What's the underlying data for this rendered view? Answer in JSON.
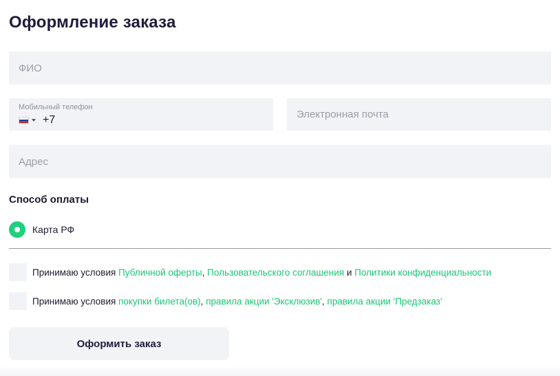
{
  "page": {
    "title": "Оформление заказа"
  },
  "form": {
    "name_placeholder": "ФИО",
    "phone": {
      "label": "Мобильный телефон",
      "country_icon": "russia-flag-icon",
      "code": "+7"
    },
    "email_placeholder": "Электронная почта",
    "address_placeholder": "Адрес"
  },
  "payment": {
    "section_title": "Способ оплаты",
    "options": [
      {
        "label": "Карта РФ",
        "selected": true
      }
    ]
  },
  "agreements": [
    {
      "prefix": "Принимаю условия ",
      "link1": "Публичной оферты",
      "sep1": ", ",
      "link2": "Пользовательского соглашения",
      "sep2": " и ",
      "link3": "Политики конфиденциальности"
    },
    {
      "prefix": "Принимаю условия ",
      "link1": "покупки билета(ов)",
      "sep1": ", ",
      "link2": "правила акции 'Эксклюзив'",
      "sep2": ", ",
      "link3": "правила акции 'Предзаказ'"
    }
  ],
  "submit_label": "Оформить заказ",
  "colors": {
    "accent": "#1fd07d",
    "link": "#19c773",
    "field_bg": "#f2f3f7",
    "title": "#1f1b3a"
  }
}
